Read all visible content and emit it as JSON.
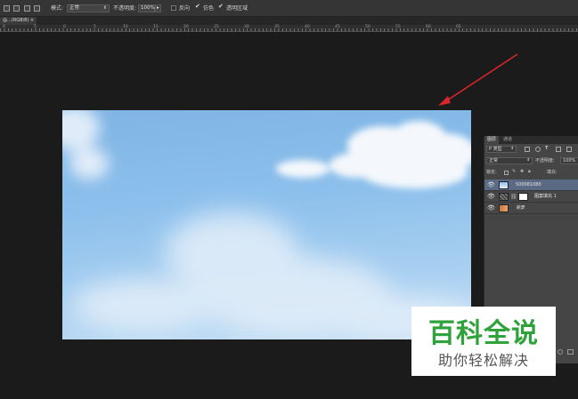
{
  "options_bar": {
    "mode_label": "模式:",
    "mode_value": "正常",
    "opacity_label": "不透明度:",
    "opacity_value": "100%",
    "reverse_label": "反向",
    "dither_label": "仿色",
    "transparency_label": "透明区域"
  },
  "document": {
    "tab_label": "@...(RGB/8) ×"
  },
  "ruler": {
    "ticks": [
      "0",
      "5",
      "0",
      "5",
      "10",
      "15",
      "20",
      "25",
      "30",
      "35",
      "40",
      "45",
      "50",
      "55",
      "60",
      "65"
    ]
  },
  "layers_panel": {
    "tabs": [
      "图层",
      "通道"
    ],
    "filter_label": "P 类型",
    "blend_mode": "正常",
    "opacity_label": "不透明度:",
    "opacity_value": "100%",
    "lock_label": "锁定:",
    "fill_label": "填充:",
    "layers": [
      {
        "name": "500081080",
        "kind": "image",
        "selected": true
      },
      {
        "name": "图案填充 1",
        "kind": "pattern",
        "selected": false
      },
      {
        "name": "背景",
        "kind": "background",
        "selected": false
      }
    ]
  },
  "watermark": {
    "title": "百科全说",
    "subtitle": "助你轻松解决"
  },
  "colors": {
    "arrow": "#d9262a",
    "watermark_green": "#2fa23c",
    "selected_layer": "#5a6a84"
  }
}
